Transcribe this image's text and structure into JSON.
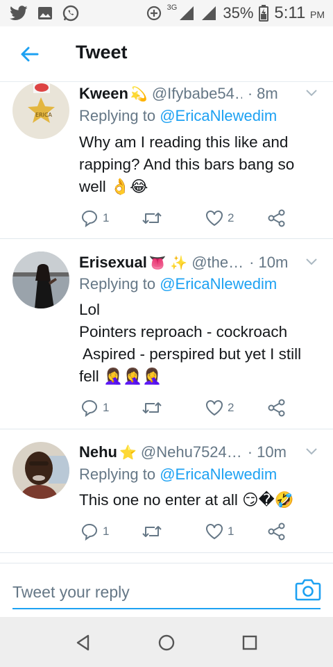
{
  "status_bar": {
    "network": "3G",
    "battery": "35%",
    "time": "5:11",
    "ampm": "PM"
  },
  "header": {
    "title": "Tweet"
  },
  "tweets": [
    {
      "name": "Kween",
      "name_emoji": "💫",
      "handle": "@Ifybabe54…",
      "time": "8m",
      "replying_prefix": "Replying to ",
      "replying_to": "@EricaNlewedim",
      "lines": [
        "Why am I reading this like and",
        "rapping? And this bars bang so",
        "well 👌😂"
      ],
      "replies": "1",
      "retweets": "",
      "likes": "2"
    },
    {
      "name": "Erisexual",
      "name_emoji": "👅 ✨",
      "handle": "@the…",
      "time": "10m",
      "replying_prefix": "Replying to ",
      "replying_to": "@EricaNlewedim",
      "lines": [
        "Lol",
        "Pointers reproach - cockroach",
        " Aspired - perspired but yet I still",
        "fell 🤦‍♀️🤦‍♀️🤦‍♀️"
      ],
      "replies": "1",
      "retweets": "",
      "likes": "2"
    },
    {
      "name": "Nehu",
      "name_emoji": "⭐",
      "handle": "@Nehu7524…",
      "time": "10m",
      "replying_prefix": "Replying to ",
      "replying_to": "@EricaNlewedim",
      "lines": [
        "This one no enter at all 😏�🤣"
      ],
      "replies": "1",
      "retweets": "",
      "likes": "1"
    }
  ],
  "reply_bar": {
    "placeholder": "Tweet your reply"
  },
  "colors": {
    "accent": "#1da1f2",
    "secondary_text": "#657786",
    "primary_text": "#14171a"
  }
}
